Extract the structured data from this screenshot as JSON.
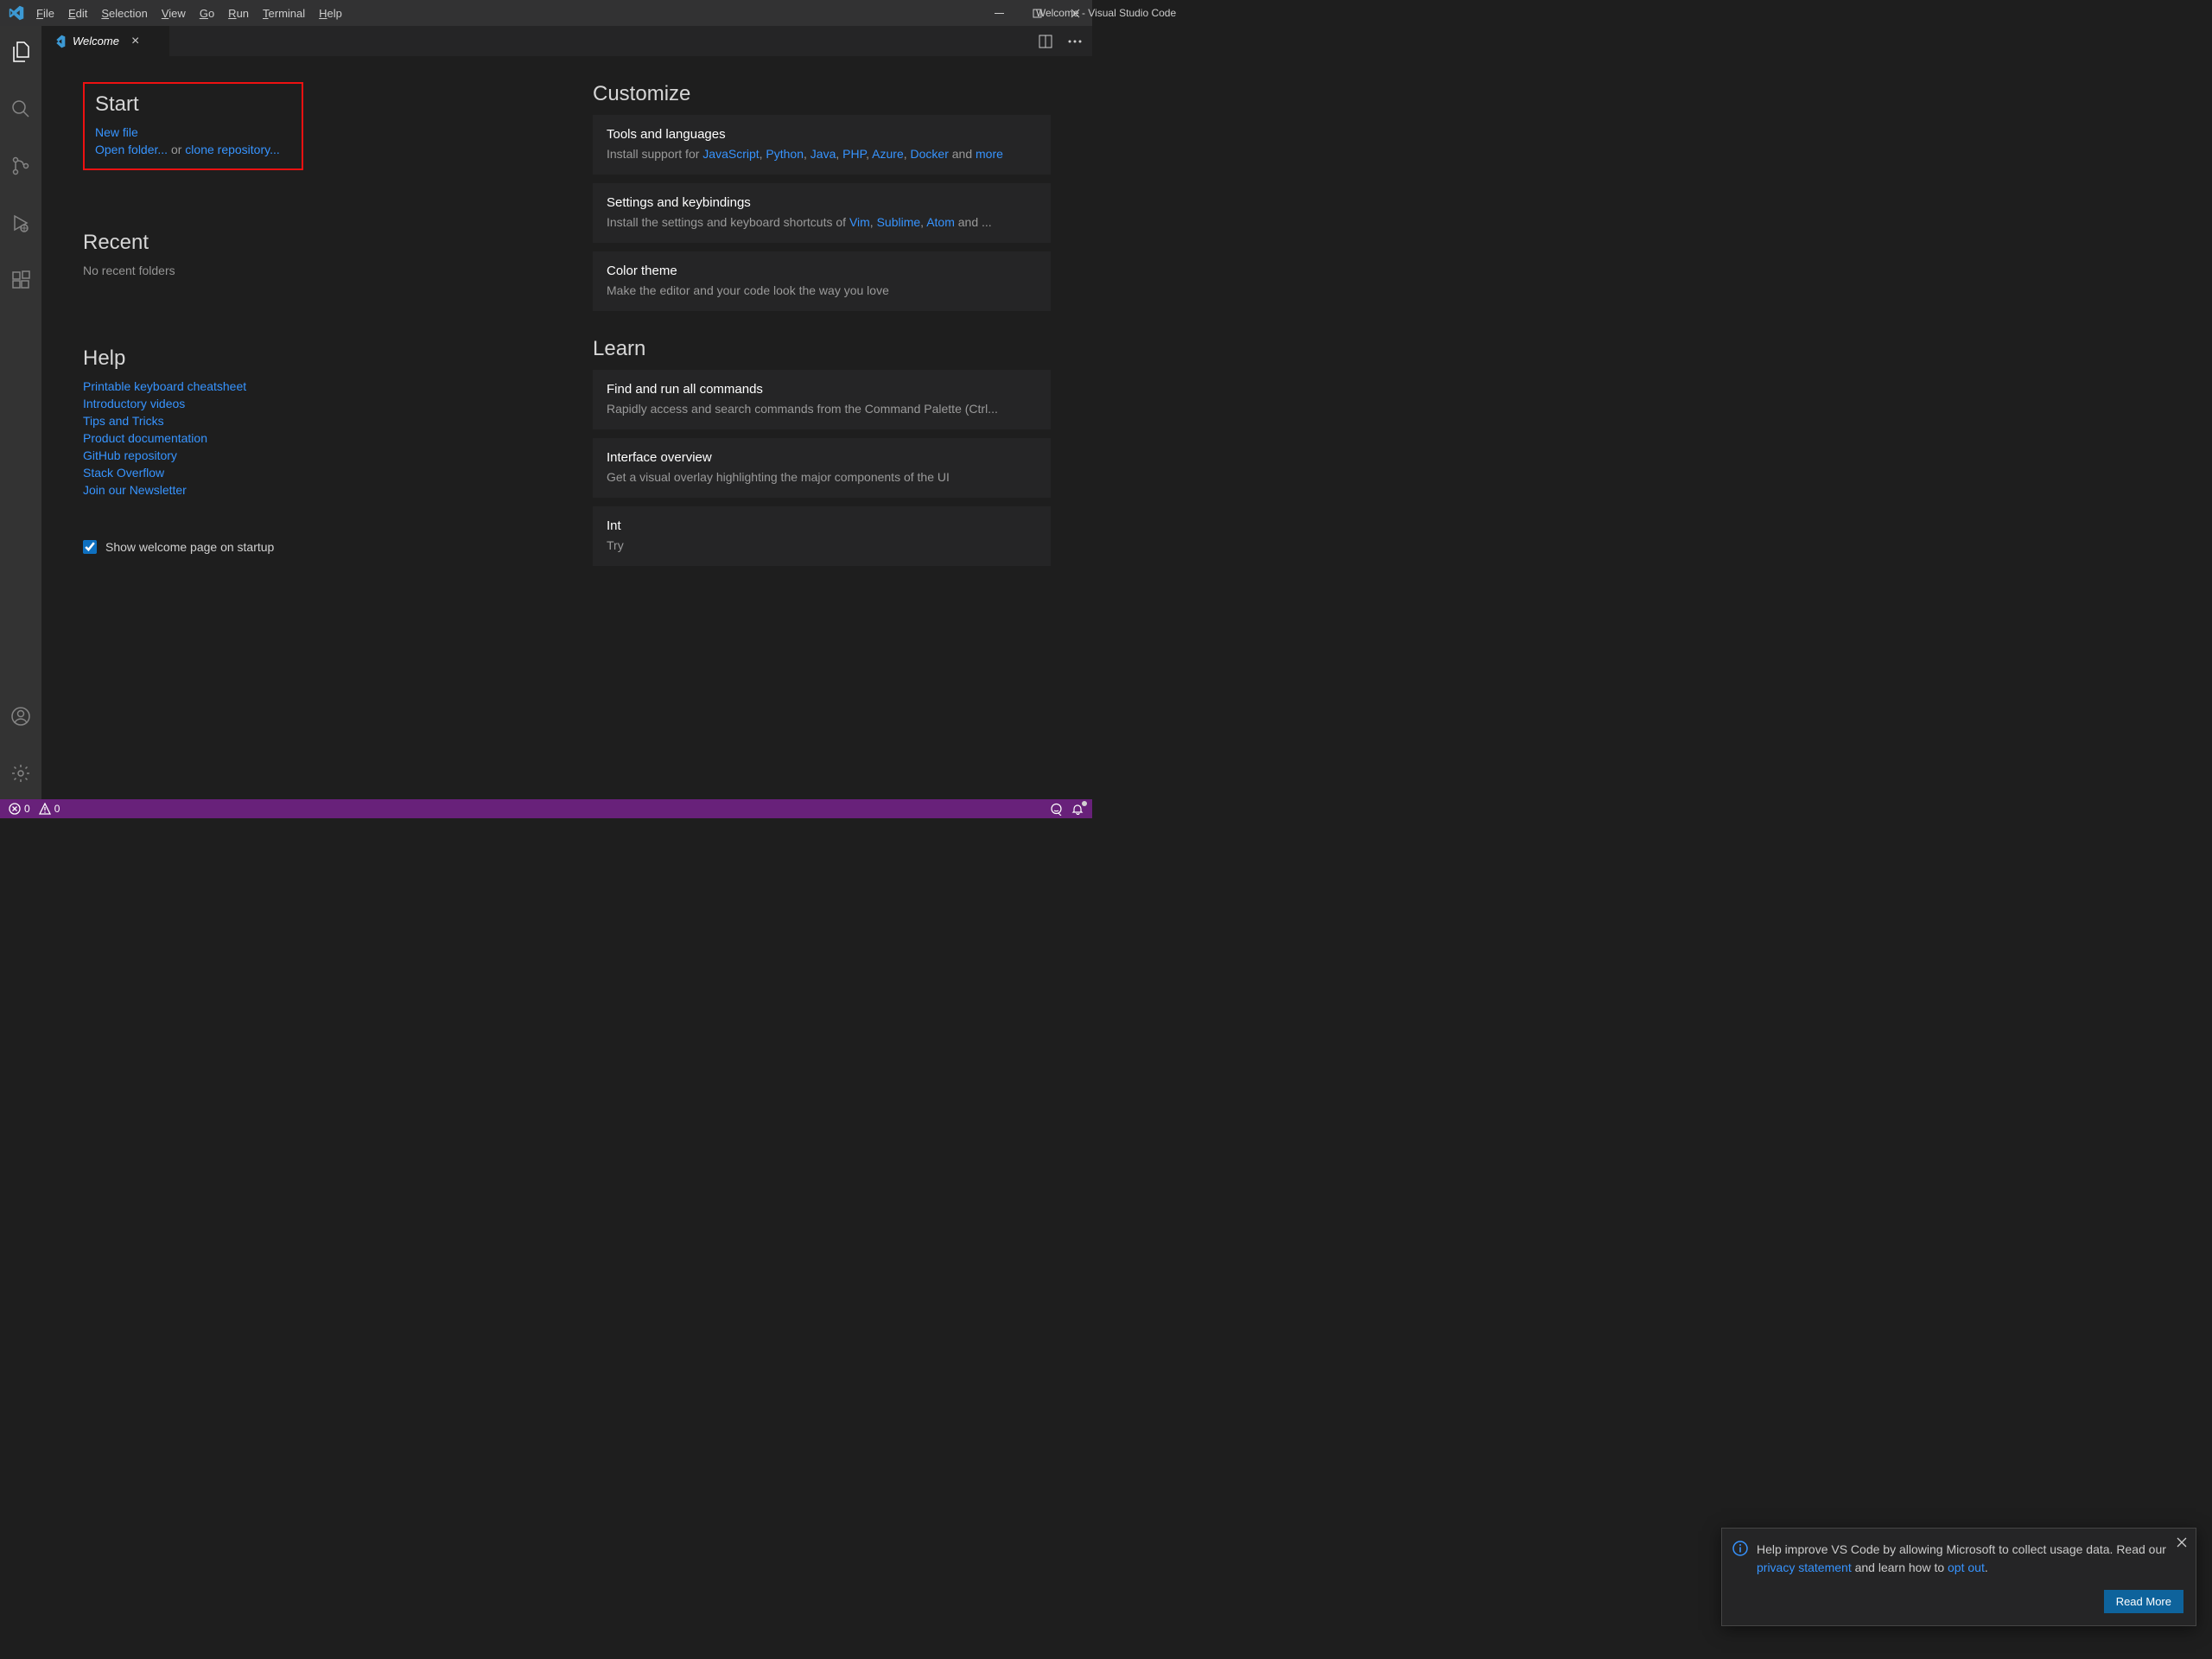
{
  "window_title": "Welcome - Visual Studio Code",
  "menu": {
    "file": "File",
    "edit": "Edit",
    "selection": "Selection",
    "view": "View",
    "go": "Go",
    "run": "Run",
    "terminal": "Terminal",
    "help": "Help"
  },
  "tab": {
    "label": "Welcome"
  },
  "welcome": {
    "start_heading": "Start",
    "new_file": "New file",
    "open_folder": "Open folder...",
    "or": " or ",
    "clone_repo": "clone repository...",
    "recent_heading": "Recent",
    "no_recent": "No recent folders",
    "help_heading": "Help",
    "help_links": [
      "Printable keyboard cheatsheet",
      "Introductory videos",
      "Tips and Tricks",
      "Product documentation",
      "GitHub repository",
      "Stack Overflow",
      "Join our Newsletter"
    ],
    "startup_label": "Show welcome page on startup",
    "customize_heading": "Customize",
    "langs_title": "Tools and languages",
    "langs_prefix": "Install support for ",
    "langs_links": [
      "JavaScript",
      "Python",
      "Java",
      "PHP",
      "Azure",
      "Docker"
    ],
    "langs_sep": ", ",
    "langs_and": " and ",
    "more": "more",
    "settings_title": "Settings and keybindings",
    "settings_prefix": "Install the settings and keyboard shortcuts of ",
    "settings_links": [
      "Vim",
      "Sublime",
      "Atom"
    ],
    "settings_suffix": " and ...",
    "theme_title": "Color theme",
    "theme_desc": "Make the editor and your code look the way you love",
    "learn_heading": "Learn",
    "cmd_title": "Find and run all commands",
    "cmd_desc": "Rapidly access and search commands from the Command Palette (Ctrl...",
    "overview_title": "Interface overview",
    "overview_desc": "Get a visual overlay highlighting the major components of the UI",
    "playground_title": "Int",
    "playground_desc": "Try"
  },
  "notification": {
    "text1": "Help improve VS Code by allowing Microsoft to collect usage data. Read our ",
    "privacy": "privacy statement",
    "text2": " and learn how to ",
    "optout": "opt out",
    "text3": ".",
    "button": "Read More"
  },
  "status": {
    "errors": "0",
    "warnings": "0"
  }
}
